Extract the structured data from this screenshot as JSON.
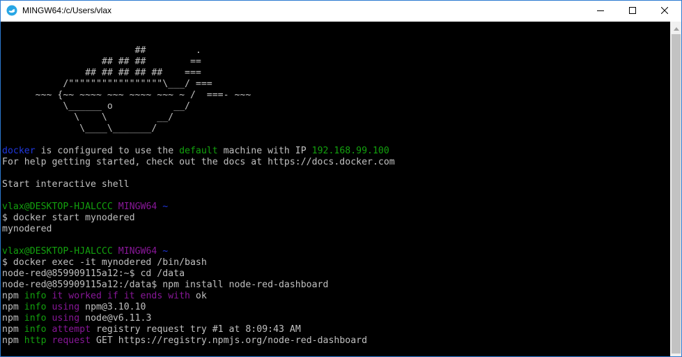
{
  "window": {
    "title": "MINGW64:/c/Users/vlax",
    "icon": "mintty-icon",
    "buttons": [
      "minimize-icon",
      "maximize-icon",
      "close-icon"
    ]
  },
  "colors": {
    "background": "#000000",
    "text": "#c0c0c0",
    "blue": "#1f37e0",
    "green": "#13a10e",
    "magenta": "#881798"
  },
  "terminal": {
    "lines": [
      {
        "segments": [
          {
            "t": "",
            "c": "white"
          }
        ]
      },
      {
        "segments": [
          {
            "t": "",
            "c": "white"
          }
        ]
      },
      {
        "segments": [
          {
            "t": "                        ##         .",
            "c": "white"
          }
        ]
      },
      {
        "segments": [
          {
            "t": "                  ## ## ##        ==",
            "c": "white"
          }
        ]
      },
      {
        "segments": [
          {
            "t": "               ## ## ## ## ##    ===",
            "c": "white"
          }
        ]
      },
      {
        "segments": [
          {
            "t": "           /\"\"\"\"\"\"\"\"\"\"\"\"\"\"\"\"\"\\___/ ===",
            "c": "white"
          }
        ]
      },
      {
        "segments": [
          {
            "t": "      ~~~ {~~ ~~~~ ~~~ ~~~~ ~~~ ~ /  ===- ~~~",
            "c": "white"
          }
        ]
      },
      {
        "segments": [
          {
            "t": "           \\______ o           __/",
            "c": "white"
          }
        ]
      },
      {
        "segments": [
          {
            "t": "             \\    \\         __/",
            "c": "white"
          }
        ]
      },
      {
        "segments": [
          {
            "t": "              \\____\\_______/",
            "c": "white"
          }
        ]
      },
      {
        "segments": [
          {
            "t": "",
            "c": "white"
          }
        ]
      },
      {
        "segments": [
          {
            "t": "docker",
            "c": "blue"
          },
          {
            "t": " is configured to use the ",
            "c": "white"
          },
          {
            "t": "default",
            "c": "green"
          },
          {
            "t": " machine with IP ",
            "c": "white"
          },
          {
            "t": "192.168.99.100",
            "c": "green"
          }
        ]
      },
      {
        "segments": [
          {
            "t": "For help getting started, check out the docs at https://docs.docker.com",
            "c": "white"
          }
        ]
      },
      {
        "segments": [
          {
            "t": "",
            "c": "white"
          }
        ]
      },
      {
        "segments": [
          {
            "t": "Start interactive shell",
            "c": "white"
          }
        ]
      },
      {
        "segments": [
          {
            "t": "",
            "c": "white"
          }
        ]
      },
      {
        "segments": [
          {
            "t": "vlax@DESKTOP-HJALCCC",
            "c": "green"
          },
          {
            "t": " ",
            "c": "white"
          },
          {
            "t": "MINGW64",
            "c": "magenta"
          },
          {
            "t": " ~",
            "c": "blue"
          }
        ]
      },
      {
        "segments": [
          {
            "t": "$ docker start mynodered",
            "c": "white"
          }
        ]
      },
      {
        "segments": [
          {
            "t": "mynodered",
            "c": "white"
          }
        ]
      },
      {
        "segments": [
          {
            "t": "",
            "c": "white"
          }
        ]
      },
      {
        "segments": [
          {
            "t": "vlax@DESKTOP-HJALCCC",
            "c": "green"
          },
          {
            "t": " ",
            "c": "white"
          },
          {
            "t": "MINGW64",
            "c": "magenta"
          },
          {
            "t": " ~",
            "c": "blue"
          }
        ]
      },
      {
        "segments": [
          {
            "t": "$ docker exec -it mynodered /bin/bash",
            "c": "white"
          }
        ]
      },
      {
        "segments": [
          {
            "t": "node-red@859909115a12:~$ cd /data",
            "c": "white"
          }
        ]
      },
      {
        "segments": [
          {
            "t": "node-red@859909115a12:/data$ npm install node-red-dashboard",
            "c": "white"
          }
        ]
      },
      {
        "segments": [
          {
            "t": "npm ",
            "c": "white"
          },
          {
            "t": "info",
            "c": "green"
          },
          {
            "t": " ",
            "c": "white"
          },
          {
            "t": "it worked if it ends with",
            "c": "magenta"
          },
          {
            "t": " ok",
            "c": "white"
          }
        ]
      },
      {
        "segments": [
          {
            "t": "npm ",
            "c": "white"
          },
          {
            "t": "info",
            "c": "green"
          },
          {
            "t": " ",
            "c": "white"
          },
          {
            "t": "using",
            "c": "magenta"
          },
          {
            "t": " npm@3.10.10",
            "c": "white"
          }
        ]
      },
      {
        "segments": [
          {
            "t": "npm ",
            "c": "white"
          },
          {
            "t": "info",
            "c": "green"
          },
          {
            "t": " ",
            "c": "white"
          },
          {
            "t": "using",
            "c": "magenta"
          },
          {
            "t": " node@v6.11.3",
            "c": "white"
          }
        ]
      },
      {
        "segments": [
          {
            "t": "npm ",
            "c": "white"
          },
          {
            "t": "info",
            "c": "green"
          },
          {
            "t": " ",
            "c": "white"
          },
          {
            "t": "attempt",
            "c": "magenta"
          },
          {
            "t": " registry request try #1 at 8:09:43 AM",
            "c": "white"
          }
        ]
      },
      {
        "segments": [
          {
            "t": "npm ",
            "c": "white"
          },
          {
            "t": "http",
            "c": "green"
          },
          {
            "t": " ",
            "c": "white"
          },
          {
            "t": "request",
            "c": "magenta"
          },
          {
            "t": " GET https://registry.npmjs.org/node-red-dashboard",
            "c": "white"
          }
        ]
      }
    ]
  }
}
